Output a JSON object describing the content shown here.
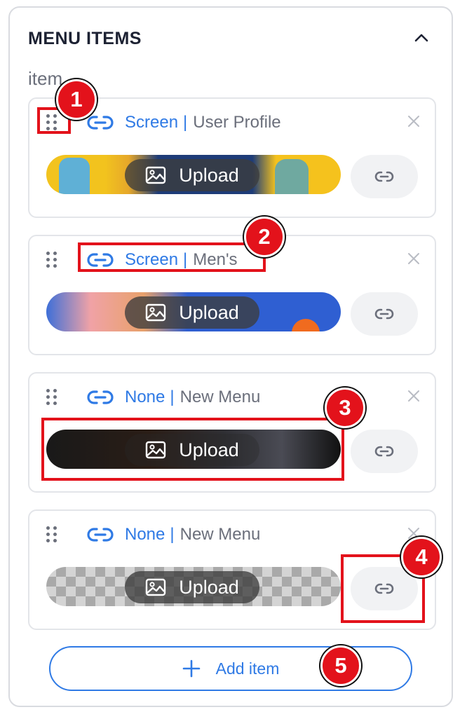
{
  "panel": {
    "title": "MENU ITEMS",
    "section_label": "item",
    "collapse_icon": "chevron-up-icon"
  },
  "items": [
    {
      "link_type": "Screen",
      "separator": "|",
      "link_name": "User Profile",
      "upload_label": "Upload",
      "banner": "yellow-portrait-banner"
    },
    {
      "link_type": "Screen",
      "separator": "|",
      "link_name": "Men's",
      "upload_label": "Upload",
      "banner": "new-arrival-banner"
    },
    {
      "link_type": "None",
      "separator": "|",
      "link_name": "New Menu",
      "upload_label": "Upload",
      "banner": "fashion-banner"
    },
    {
      "link_type": "None",
      "separator": "|",
      "link_name": "New Menu",
      "upload_label": "Upload",
      "banner": "empty-transparent"
    }
  ],
  "add_item": {
    "label": "Add item",
    "icon": "plus-icon"
  },
  "callouts": [
    "1",
    "2",
    "3",
    "4",
    "5"
  ],
  "colors": {
    "accent": "#2f7ae5",
    "callout": "#e3121b",
    "text_muted": "#6b6f7b",
    "title": "#1d2233"
  }
}
